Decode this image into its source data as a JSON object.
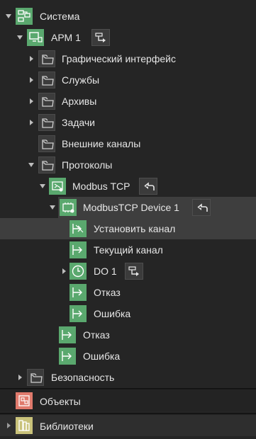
{
  "tree": {
    "root": {
      "label": "Система"
    },
    "arm": {
      "label": "АРМ 1"
    },
    "items": {
      "graphic": "Графический интерфейс",
      "services": "Службы",
      "archives": "Архивы",
      "tasks": "Задачи",
      "external": "Внешние каналы",
      "protocols": "Протоколы",
      "modbus": "Modbus TCP",
      "device": "ModbusTCP Device 1",
      "set_channel": "Установить канал",
      "current_channel": "Текущий канал",
      "do1": "DO 1",
      "fail_inner": "Отказ",
      "error_inner": "Ошибка",
      "fail_outer": "Отказ",
      "error_outer": "Ошибка",
      "security": "Безопасность"
    }
  },
  "panels": {
    "objects": "Объекты",
    "libraries": "Библиотеки"
  },
  "colors": {
    "background": "#252525",
    "selected_row": "#3e3e3e",
    "green_icon": "#5aa86e",
    "objects_icon": "#e07a6c",
    "libraries_icon": "#c9c27a"
  }
}
